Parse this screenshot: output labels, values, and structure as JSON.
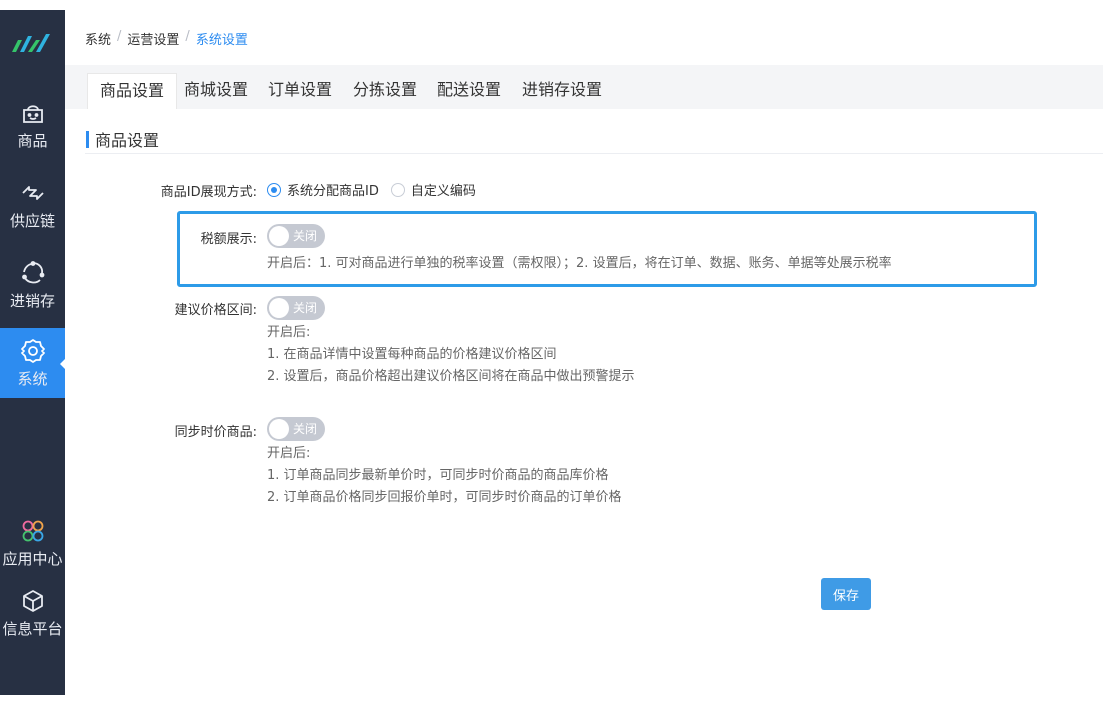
{
  "sidebar": {
    "items": [
      {
        "label": "商品",
        "icon": "shopping-bag-icon"
      },
      {
        "label": "供应链",
        "icon": "swap-arrows-icon"
      },
      {
        "label": "进销存",
        "icon": "cycle-icon"
      },
      {
        "label": "系统",
        "icon": "gear-icon",
        "active": true
      },
      {
        "label": "应用中心",
        "icon": "app-grid-icon"
      },
      {
        "label": "信息平台",
        "icon": "cube-icon"
      }
    ]
  },
  "breadcrumb": {
    "items": [
      "系统",
      "运营设置",
      "系统设置"
    ],
    "separator": "/"
  },
  "tabs": [
    "商品设置",
    "商城设置",
    "订单设置",
    "分拣设置",
    "配送设置",
    "进销存设置"
  ],
  "section": {
    "title": "商品设置"
  },
  "form": {
    "id_display": {
      "label": "商品ID展现方式:",
      "options": [
        "系统分配商品ID",
        "自定义编码"
      ],
      "selected": "系统分配商品ID"
    },
    "tax_display": {
      "label": "税额展示:",
      "switch_text": "关闭",
      "desc": "开启后：1. 可对商品进行单独的税率设置（需权限）；2. 设置后，将在订单、数据、账务、单据等处展示税率"
    },
    "price_range": {
      "label": "建议价格区间:",
      "switch_text": "关闭",
      "desc_lines": [
        "开启后:",
        "1. 在商品详情中设置每种商品的价格建议价格区间",
        "2. 设置后，商品价格超出建议价格区间将在商品中做出预警提示"
      ]
    },
    "sync_price": {
      "label": "同步时价商品:",
      "switch_text": "关闭",
      "desc_lines": [
        "开启后:",
        "1. 订单商品同步最新单价时，可同步时价商品的商品库价格",
        "2. 订单商品价格同步回报价单时，可同步时价商品的订单价格"
      ]
    }
  },
  "save_label": "保存",
  "colors": {
    "sidebar_bg": "#273043",
    "accent": "#2d8cf0",
    "highlight": "#2d9be8"
  }
}
